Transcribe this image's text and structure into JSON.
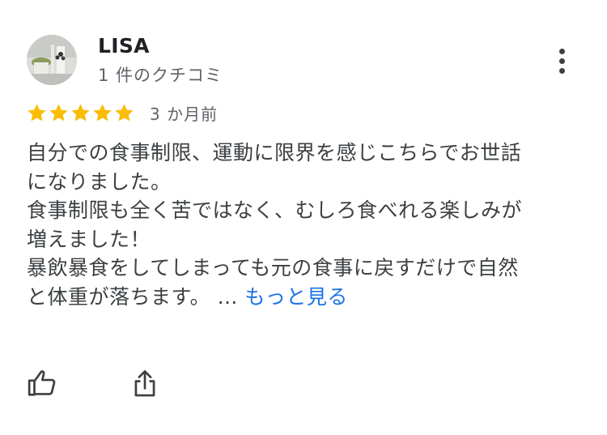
{
  "review": {
    "author": "LISA",
    "review_count": "1 件のクチコミ",
    "rating": 5,
    "rating_max": 5,
    "date": "3 か月前",
    "lines": [
      "自分での食事制限、運動に限界を感じこちらでお世話",
      "になりました。",
      "食事制限も全く苦ではなく、むしろ食べれる楽しみが",
      "増えました！",
      "暴飲暴食をしてしまっても元の食事に戻すだけで自然",
      "と体重が落ちます。 …"
    ],
    "more_label": "もっと見る"
  },
  "icons": {
    "menu": "more-vert-icon",
    "star": "star-icon",
    "like": "thumbs-up-icon",
    "share": "share-icon"
  },
  "colors": {
    "star": "#fbbc04",
    "link": "#1a73e8",
    "text": "#3c4043",
    "secondary": "#5f6368"
  }
}
